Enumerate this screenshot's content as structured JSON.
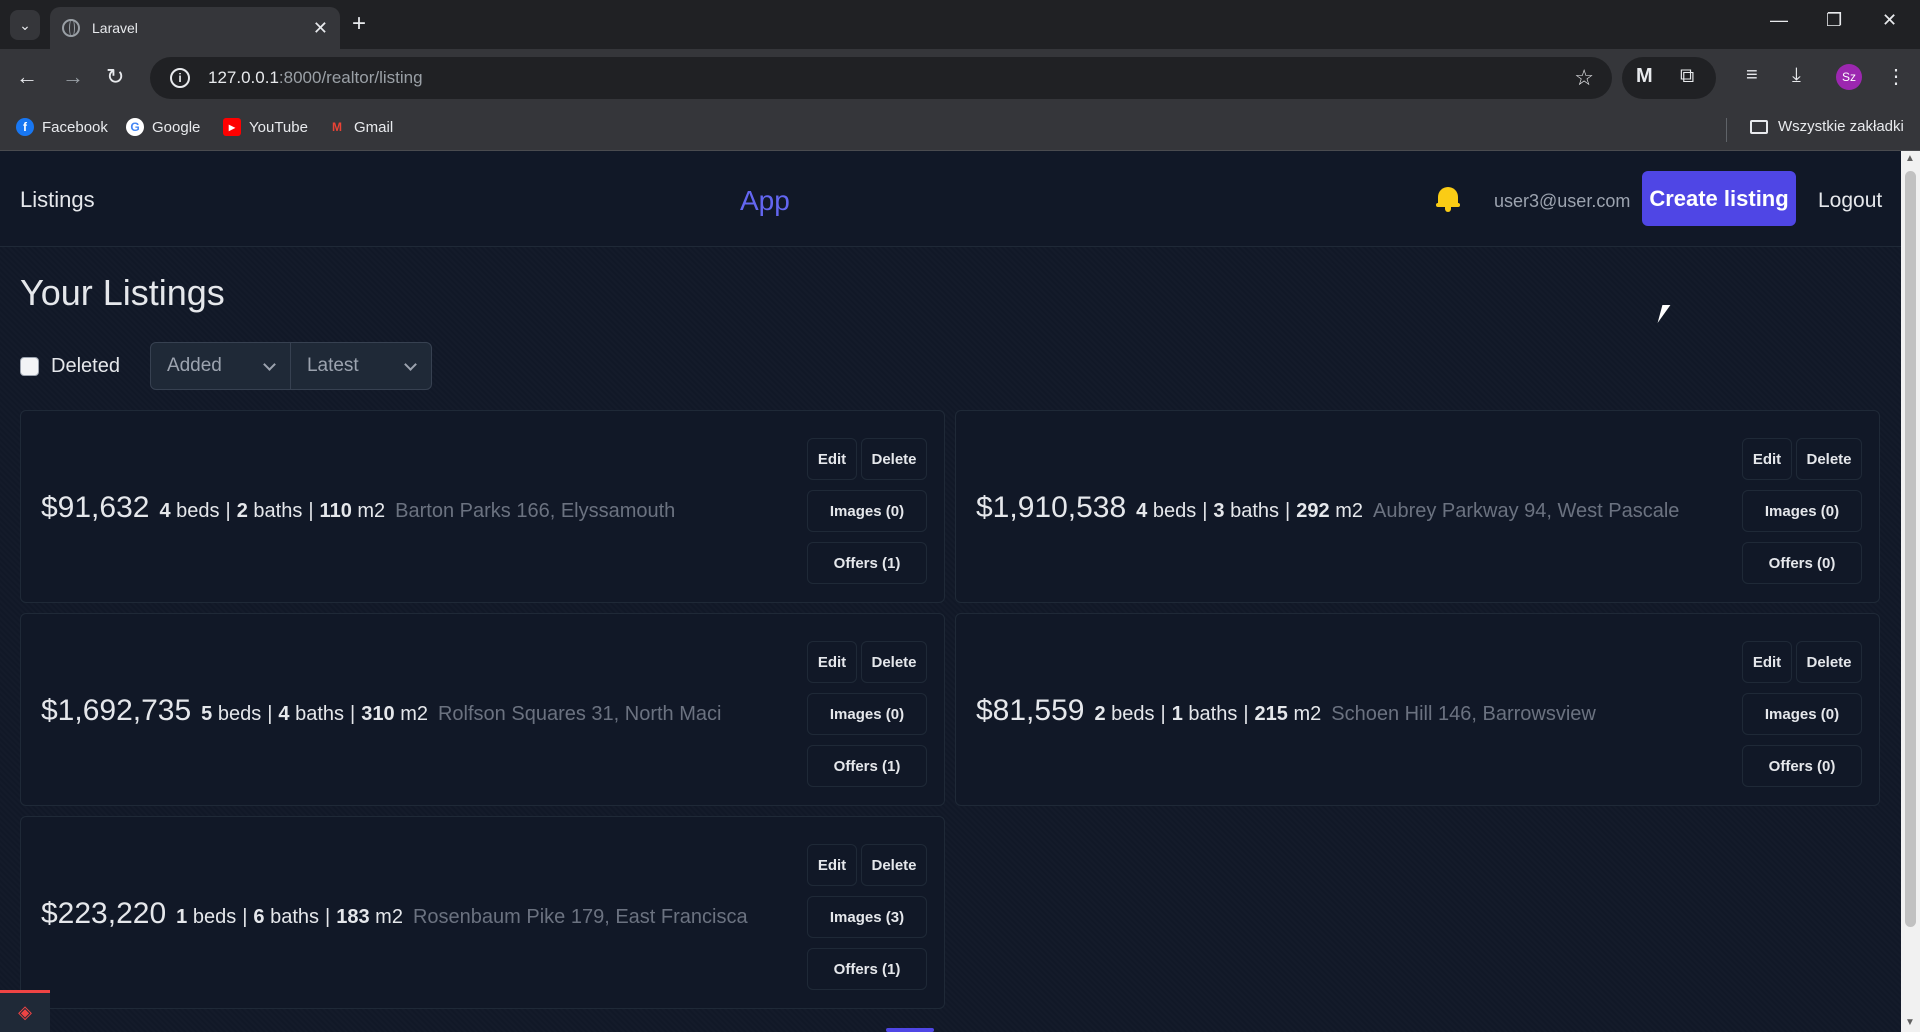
{
  "browser": {
    "tab_title": "Laravel",
    "url_host": "127.0.0.1",
    "url_rest": ":8000/realtor/listing",
    "bookmarks": [
      {
        "label": "Facebook",
        "color": "#1877f2"
      },
      {
        "label": "Google",
        "color": "#ffffff"
      },
      {
        "label": "YouTube",
        "color": "#ff0000"
      },
      {
        "label": "Gmail",
        "color": "#ea4335"
      }
    ],
    "all_bookmarks_label": "Wszystkie zakładki",
    "profile_initials": "Sz"
  },
  "header": {
    "nav_listings": "Listings",
    "brand": "App",
    "user_email": "user3@user.com",
    "create_label": "Create listing",
    "logout_label": "Logout"
  },
  "page": {
    "title": "Your Listings",
    "filters": {
      "deleted_label": "Deleted",
      "sort_by": "Added",
      "order": "Latest"
    }
  },
  "listings": [
    {
      "price": "$91,632",
      "beds": "4",
      "baths": "2",
      "area": "110",
      "address": "Barton Parks 166, Elyssamouth",
      "images": "Images (0)",
      "offers": "Offers (1)"
    },
    {
      "price": "$1,910,538",
      "beds": "4",
      "baths": "3",
      "area": "292",
      "address": "Aubrey Parkway 94, West Pascale",
      "images": "Images (0)",
      "offers": "Offers (0)"
    },
    {
      "price": "$1,692,735",
      "beds": "5",
      "baths": "4",
      "area": "310",
      "address": "Rolfson Squares 31, North Maci",
      "images": "Images (0)",
      "offers": "Offers (1)"
    },
    {
      "price": "$81,559",
      "beds": "2",
      "baths": "1",
      "area": "215",
      "address": "Schoen Hill 146, Barrowsview",
      "images": "Images (0)",
      "offers": "Offers (0)"
    },
    {
      "price": "$223,220",
      "beds": "1",
      "baths": "6",
      "area": "183",
      "address": "Rosenbaum Pike 179, East Francisca",
      "images": "Images (3)",
      "offers": "Offers (1)"
    }
  ],
  "labels": {
    "beds": "beds",
    "baths": "baths",
    "area_unit": "m2",
    "edit": "Edit",
    "delete": "Delete"
  },
  "colors": {
    "accent": "#4f46e5",
    "brand": "#6366f1",
    "background": "#111827",
    "bell": "#facc15"
  }
}
